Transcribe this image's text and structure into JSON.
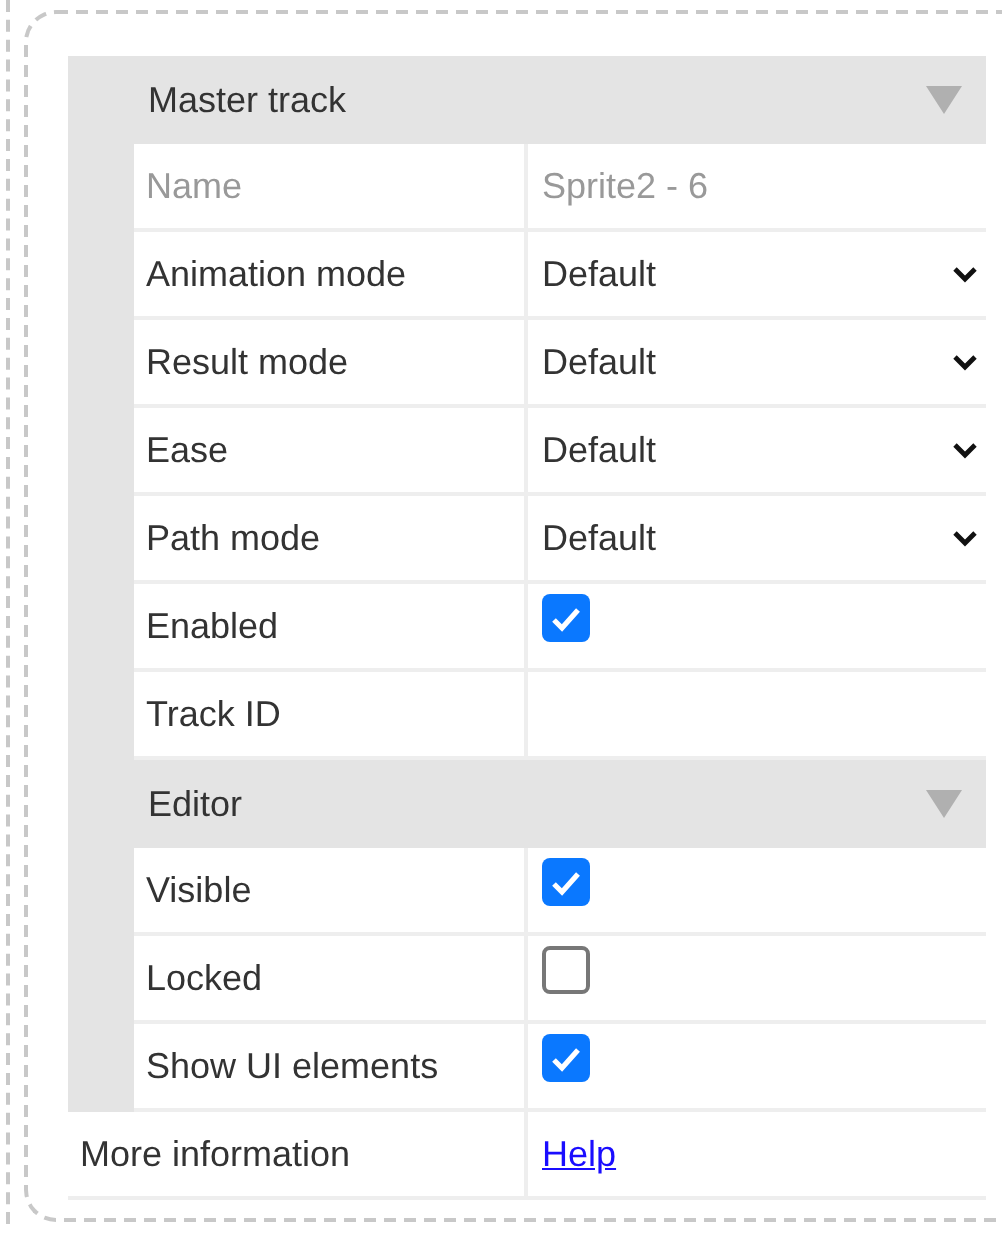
{
  "sections": [
    {
      "title": "Master track",
      "expanded": true,
      "rows": [
        {
          "kind": "text",
          "label": "Name",
          "value": "Sprite2 - 6",
          "disabled": true
        },
        {
          "kind": "select",
          "label": "Animation mode",
          "value": "Default",
          "disabled": false
        },
        {
          "kind": "select",
          "label": "Result mode",
          "value": "Default",
          "disabled": false
        },
        {
          "kind": "select",
          "label": "Ease",
          "value": "Default",
          "disabled": false
        },
        {
          "kind": "select",
          "label": "Path mode",
          "value": "Default",
          "disabled": false
        },
        {
          "kind": "checkbox",
          "label": "Enabled",
          "checked": true,
          "disabled": false
        },
        {
          "kind": "text",
          "label": "Track ID",
          "disabled": false
        }
      ]
    },
    {
      "title": "Editor",
      "expanded": true,
      "rows": [
        {
          "kind": "checkbox",
          "label": "Visible",
          "checked": true,
          "disabled": false
        },
        {
          "kind": "checkbox",
          "label": "Locked",
          "checked": false,
          "disabled": false
        },
        {
          "kind": "checkbox",
          "label": "Show UI elements",
          "checked": true,
          "disabled": false
        }
      ]
    }
  ],
  "footer": {
    "label": "More information",
    "link": "Help"
  }
}
